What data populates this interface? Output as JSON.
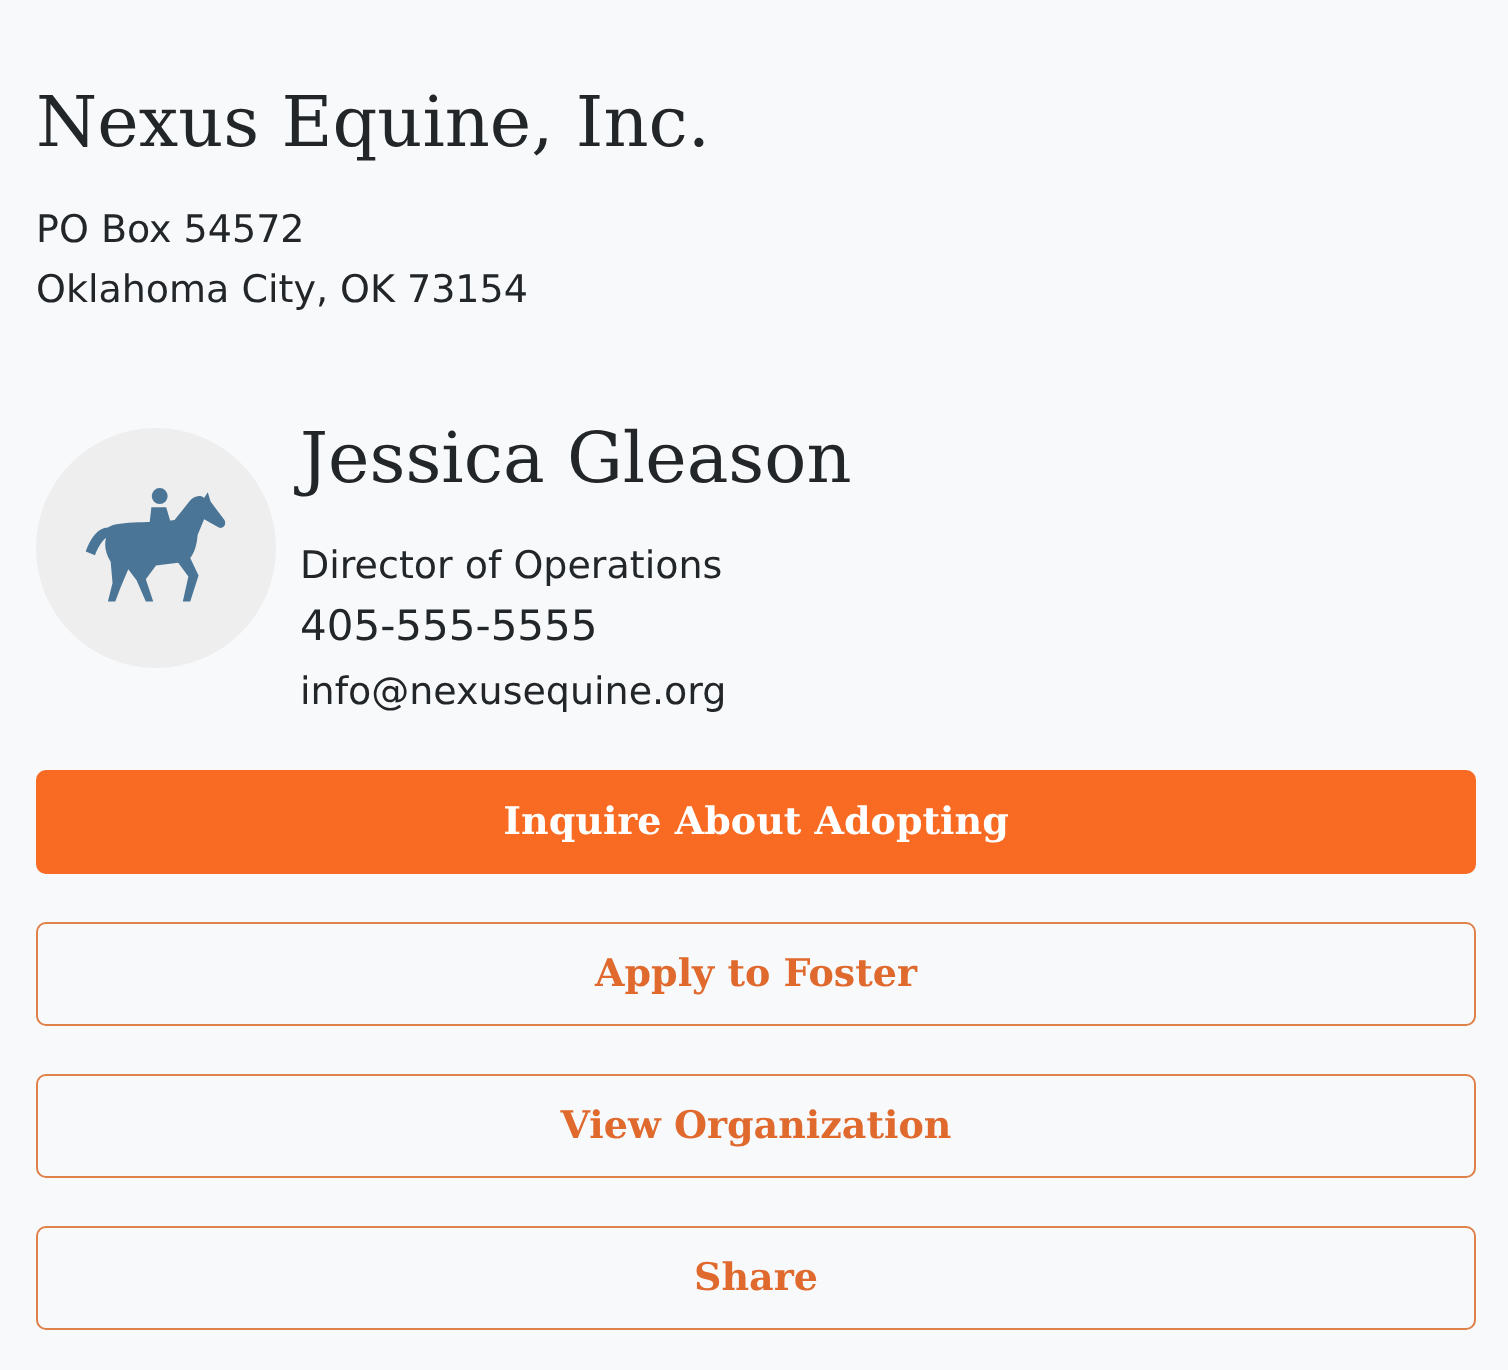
{
  "organization": {
    "name": "Nexus Equine, Inc.",
    "address_lines": [
      "PO Box 54572",
      "Oklahoma City, OK 73154"
    ]
  },
  "contact": {
    "name": "Jessica Gleason",
    "role": "Director of Operations",
    "phone": "405-555-5555",
    "email": "info@nexusequine.org"
  },
  "buttons": [
    {
      "label": "Inquire About Adopting",
      "kind": "primary"
    },
    {
      "label": "Apply to Foster",
      "kind": "outline"
    },
    {
      "label": "View Organization",
      "kind": "outline"
    },
    {
      "label": "Share",
      "kind": "outline"
    }
  ]
}
